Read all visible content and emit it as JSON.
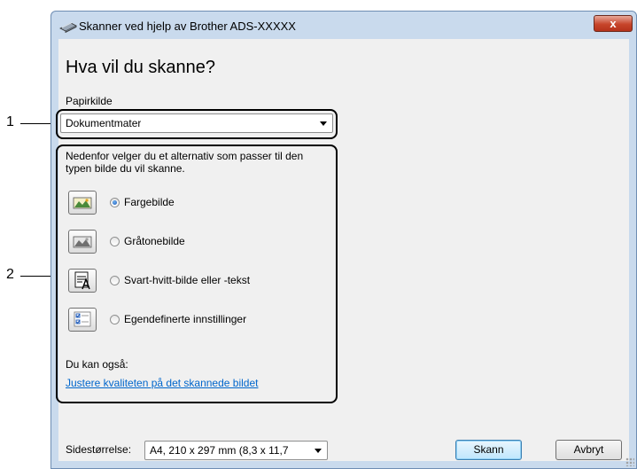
{
  "window": {
    "title": "Skanner ved hjelp av Brother ADS-XXXXX",
    "close_label": "x"
  },
  "heading": "Hva vil du skanne?",
  "paper_source": {
    "label": "Papirkilde",
    "value": "Dokumentmater"
  },
  "description": "Nedenfor velger du et alternativ som passer til den typen bilde du vil skanne.",
  "options": [
    {
      "label": "Fargebilde",
      "icon": "color-picture-icon",
      "selected": true
    },
    {
      "label": "Gråtonebilde",
      "icon": "grayscale-picture-icon",
      "selected": false
    },
    {
      "label": "Svart-hvitt-bilde eller -tekst",
      "icon": "black-white-text-icon",
      "selected": false
    },
    {
      "label": "Egendefinerte innstillinger",
      "icon": "custom-settings-icon",
      "selected": false
    }
  ],
  "also_label": "Du kan også:",
  "adjust_link": "Justere kvaliteten på det skannede bildet",
  "page_size": {
    "label": "Sidestørrelse:",
    "value": "A4, 210 x 297 mm (8,3 x 11,7"
  },
  "buttons": {
    "scan": "Skann",
    "cancel": "Avbryt"
  },
  "callouts": [
    "1",
    "2"
  ]
}
